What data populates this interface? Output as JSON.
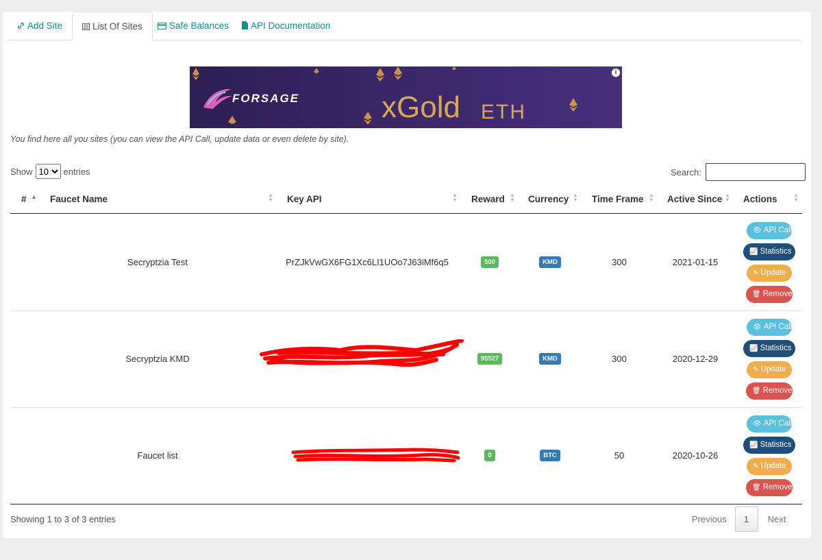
{
  "tabs": [
    {
      "label": "Add Site",
      "icon": "link-icon"
    },
    {
      "label": "List Of Sites",
      "icon": "list-icon"
    },
    {
      "label": "Safe Balances",
      "icon": "credit-card-icon"
    },
    {
      "label": "API Documentation",
      "icon": "file-icon"
    }
  ],
  "banner": {
    "brand": "FORSAGE",
    "headline": "xGold",
    "suffix": "ETH"
  },
  "intro": "You find here all you sites (you can view the API Call, update data or even delete by site).",
  "length": {
    "show_label": "Show",
    "value": "10",
    "options": [
      "10"
    ],
    "entries_label": "entries"
  },
  "search": {
    "label": "Search:",
    "value": ""
  },
  "table": {
    "headers": {
      "num": "#",
      "name": "Faucet Name",
      "key": "Key API",
      "reward": "Reward",
      "currency": "Currency",
      "timeframe": "Time Frame",
      "active": "Active Since",
      "actions": "Actions"
    },
    "rows": [
      {
        "name": "Secryptzia Test",
        "key": "PrZJkVwGX6FG1Xc6LI1UOo7J63iMf6q5",
        "reward": "500",
        "currency": "KMD",
        "timeframe": "300",
        "active": "2021-01-15",
        "key_redacted": false
      },
      {
        "name": "Secryptzia KMD",
        "key": "",
        "reward": "95527",
        "currency": "KMD",
        "timeframe": "300",
        "active": "2020-12-29",
        "key_redacted": true
      },
      {
        "name": "Faucet list",
        "key": "",
        "reward": "0",
        "currency": "BTC",
        "timeframe": "50",
        "active": "2020-10-26",
        "key_redacted": true
      }
    ],
    "buttons": {
      "api": "API Call",
      "stats": "Statistics",
      "update": "Update",
      "remove": "Remove"
    }
  },
  "footer": {
    "info": "Showing 1 to 3 of 3 entries",
    "prev": "Previous",
    "page": "1",
    "next": "Next"
  },
  "colors": {
    "link": "#1a8a8a",
    "api": "#5bc0de",
    "stats": "#1e4f7a",
    "update": "#f0ad4e",
    "remove": "#d9534f",
    "green": "#5cb85c",
    "blue": "#337ab7",
    "redact": "#ff0000"
  }
}
